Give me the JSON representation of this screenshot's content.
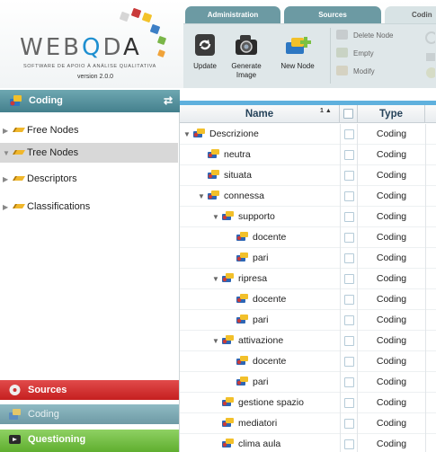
{
  "app": {
    "logo_text": "WEBQDA",
    "tagline": "SOFTWARE DE APOIO À ANÁLISE QUALITATIVA",
    "version": "version 2.0.0"
  },
  "tabs": [
    {
      "label": "Administration"
    },
    {
      "label": "Sources"
    },
    {
      "label": "Codin"
    }
  ],
  "ribbon": {
    "update": "Update",
    "generate": "Generate Image",
    "new_node": "New Node",
    "delete_node": "Delete Node",
    "empty": "Empty",
    "modify": "Modify"
  },
  "left": {
    "header": "Coding",
    "items": [
      {
        "label": "Free Nodes"
      },
      {
        "label": "Tree Nodes"
      },
      {
        "label": "Descriptors"
      },
      {
        "label": "Classifications"
      }
    ],
    "sections": {
      "sources": "Sources",
      "coding": "Coding",
      "questioning": "Questioning"
    }
  },
  "grid": {
    "col_name": "Name",
    "col_sort": "1 ▲",
    "col_type": "Type",
    "rows": [
      {
        "name": "Descrizione",
        "type": "Coding"
      },
      {
        "name": "neutra",
        "type": "Coding"
      },
      {
        "name": "situata",
        "type": "Coding"
      },
      {
        "name": "connessa",
        "type": "Coding"
      },
      {
        "name": "supporto",
        "type": "Coding"
      },
      {
        "name": "docente",
        "type": "Coding"
      },
      {
        "name": "pari",
        "type": "Coding"
      },
      {
        "name": "ripresa",
        "type": "Coding"
      },
      {
        "name": "docente",
        "type": "Coding"
      },
      {
        "name": "pari",
        "type": "Coding"
      },
      {
        "name": "attivazione",
        "type": "Coding"
      },
      {
        "name": "docente",
        "type": "Coding"
      },
      {
        "name": "pari",
        "type": "Coding"
      },
      {
        "name": "gestione spazio",
        "type": "Coding"
      },
      {
        "name": "mediatori",
        "type": "Coding"
      },
      {
        "name": "clima aula",
        "type": "Coding"
      }
    ]
  },
  "colors": {
    "accent_blue": "#5fb0dd",
    "sources_red": "#d23434",
    "questioning_green": "#74c246",
    "panel_teal": "#4e8c98"
  }
}
